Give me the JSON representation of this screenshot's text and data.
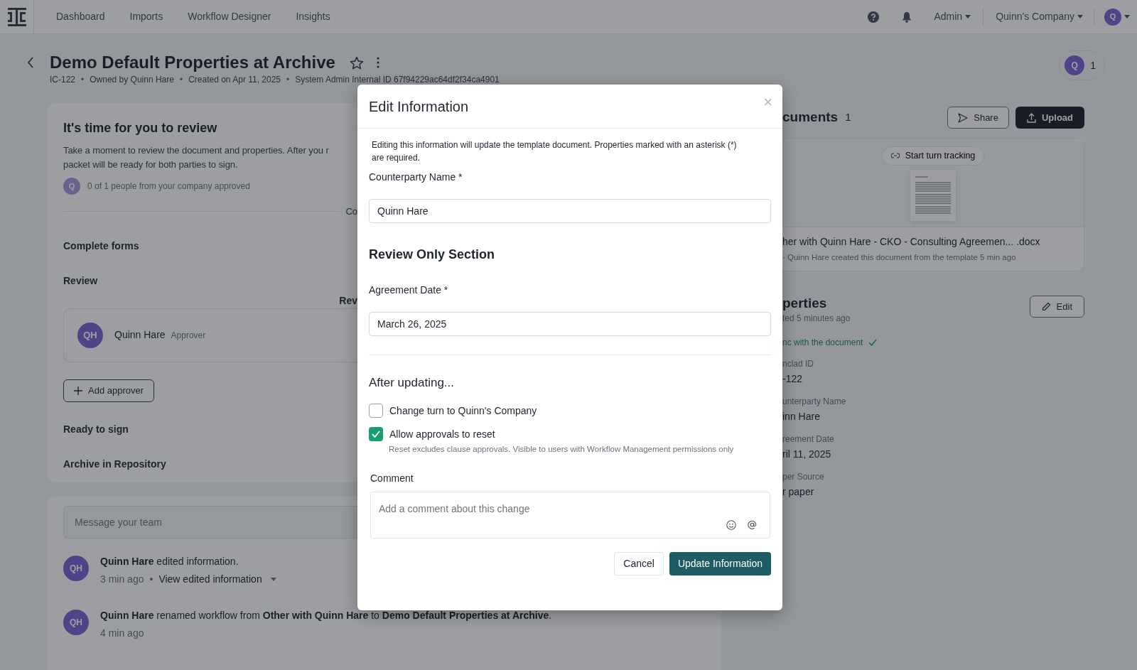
{
  "navbar": {
    "links": [
      "Dashboard",
      "Imports",
      "Workflow Designer",
      "Insights"
    ],
    "admin_menu": "Admin",
    "company_menu": "Quinn's Company",
    "avatar": "Q"
  },
  "header": {
    "title": "Demo Default Properties at Archive",
    "meta": [
      "IC-122",
      "Owned by Quinn Hare",
      "Created on Apr 11, 2025",
      "System Admin Internal ID 67f94229ac64df2f34ca4901"
    ],
    "separator": "•",
    "collaborators": {
      "avatar": "Q",
      "count": "1"
    }
  },
  "review_card": {
    "title": "It's time for you to review",
    "description": "Take a moment to review the document and properties. After you r\npacket will be ready for both parties to sign.",
    "approval": {
      "avatar": "Q",
      "text": "0 of 1 people from your company approved"
    },
    "divider_label": "Co",
    "steps": [
      {
        "label": "Complete forms"
      },
      {
        "label": "Review",
        "approvers_label": "Rev",
        "approvers": [
          {
            "initials": "QH",
            "name": "Quinn Hare",
            "role": "Approver"
          }
        ],
        "add_button": "Add approver"
      },
      {
        "label": "Ready to sign"
      },
      {
        "label": "Archive in Repository"
      }
    ]
  },
  "activity": {
    "message_placeholder": "Message your team",
    "items": [
      {
        "initials": "QH",
        "text": "**Quinn Hare** edited information.",
        "time": "3 min ago",
        "separator": "•",
        "link": "View edited information"
      },
      {
        "initials": "QH",
        "text": "**Quinn Hare** renamed workflow from **Other with Quinn Hare** to **Demo Default Properties at Archive**.",
        "time": "4 min ago"
      }
    ]
  },
  "documents": {
    "heading": "cuments",
    "count": "1",
    "share_button": "Share",
    "upload_button": "Upload",
    "card": {
      "tracking_button": "Start turn tracking",
      "file_name": "her with Quinn Hare - CKO - Consulting Agreemen... .docx",
      "meta": "· Quinn Hare created this document from the template 5 min ago"
    }
  },
  "properties": {
    "heading": "perties",
    "updated": "ted 5 minutes ago",
    "edit_button": "Edit",
    "sync_status": "nc with the document",
    "fields": [
      {
        "label": "nclad ID",
        "value": "-122"
      },
      {
        "label": "unterparty Name",
        "value": "inn Hare"
      },
      {
        "label": "reement Date",
        "value": "ril 11, 2025"
      },
      {
        "label": "per Source",
        "value": "r paper"
      }
    ]
  },
  "modal": {
    "title": "Edit Information",
    "close": "×",
    "notice": "Editing this information will update the template document. Properties marked with an asterisk (*) are required.",
    "items": [
      {
        "kind": "field",
        "label": "Counterparty Name *",
        "value": "Quinn Hare"
      },
      {
        "kind": "heading",
        "label": "Review Only Section"
      },
      {
        "kind": "field",
        "label": "Agreement Date *",
        "value": "March 26, 2025"
      }
    ],
    "after_title": "After updating...",
    "options": [
      {
        "label": "Change turn to Quinn's Company",
        "checked": false
      },
      {
        "label": "Allow approvals to reset",
        "checked": true,
        "hint": "Reset excludes clause approvals. Visible to users with Workflow Management permissions only"
      }
    ],
    "comment": {
      "label": "Comment",
      "placeholder": "Add a comment about this change"
    },
    "cancel_button": "Cancel",
    "submit_button": "Update Information"
  }
}
